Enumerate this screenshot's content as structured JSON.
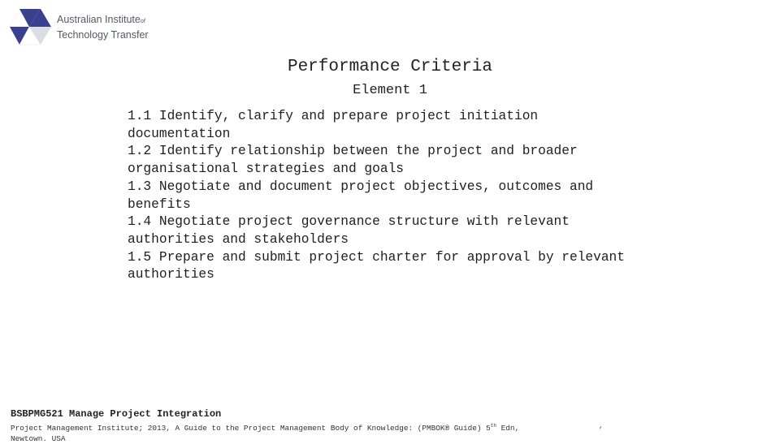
{
  "logo": {
    "line1": "Australian Institute",
    "line1_suffix": "of",
    "line2": "Technology Transfer",
    "colors": {
      "dark_blue": "#3a3f8f",
      "white": "#ffffff",
      "light_gray": "#dcdde3"
    }
  },
  "slide": {
    "title": "Performance Criteria",
    "subtitle": "Element 1",
    "criteria_lines": [
      "1.1 Identify, clarify and prepare project initiation",
      "documentation",
      "1.2 Identify relationship between the project and broader",
      "organisational strategies and goals",
      "1.3 Negotiate and document project objectives, outcomes and",
      "benefits",
      "1.4 Negotiate project governance structure with relevant",
      "authorities and stakeholders",
      "1.5 Prepare and submit project charter for approval by relevant",
      "authorities"
    ]
  },
  "footer": {
    "course_title": "BSBPMG521 Manage Project Integration",
    "citation_line1_prefix": "Project Management Institute; 2013, A Guide to the Project Management Body of Knowledge: (PMBOK® Guide) 5",
    "citation_superscript": "th",
    "citation_line1_suffix": " Edn,",
    "citation_line2": "Newtown. USA",
    "trailing_mark": ","
  }
}
